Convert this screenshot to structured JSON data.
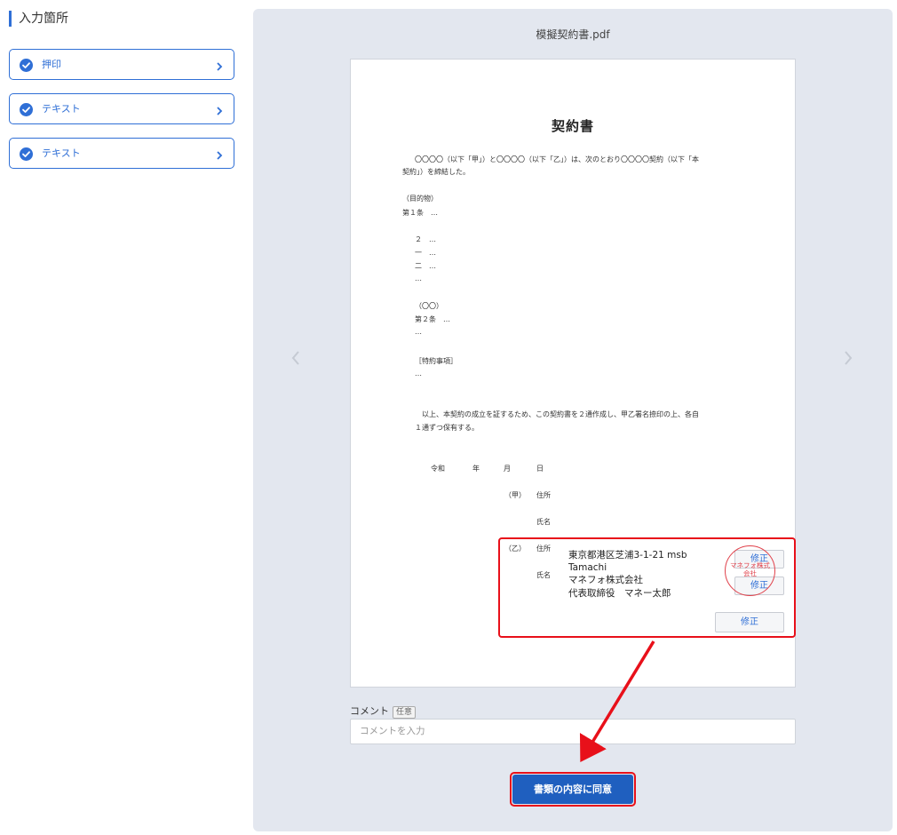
{
  "sidebar": {
    "title": "入力箇所",
    "items": [
      {
        "label": "押印"
      },
      {
        "label": "テキスト"
      },
      {
        "label": "テキスト"
      }
    ]
  },
  "viewer": {
    "filename": "模擬契約書.pdf",
    "doc_title": "契約書",
    "lines": [
      "〇〇〇〇（以下「甲」）と〇〇〇〇（以下「乙」）は、次のとおり〇〇〇〇契約（以下「本",
      "契約」）を締結した。",
      "（目的物）",
      "第１条　…",
      "２　…",
      "一　…",
      "二　…",
      "…",
      "（〇〇）",
      "第２条　…",
      "…",
      "［特約事項］",
      "…",
      "以上、本契約の成立を証するため、この契約書を２通作成し、甲乙署名捺印の上、各自",
      "１通ずつ保有する。"
    ],
    "date_row": {
      "era": "令和",
      "year": "年",
      "month": "月",
      "day": "日"
    },
    "party_a": {
      "tag": "（甲）",
      "address_label": "住所",
      "name_label": "氏名"
    },
    "party_b": {
      "tag": "（乙）",
      "address_label": "住所",
      "name_label": "氏名"
    },
    "signature": {
      "address_line1": "東京都港区芝浦3-1-21 msb",
      "address_line2": "Tamachi",
      "company": "マネフォ株式会社",
      "representative": "代表取締役　マネー太郎"
    },
    "stamp_text_1": "マネフォ株式",
    "stamp_text_2": "会社",
    "fix_button_label": "修正"
  },
  "comment": {
    "label": "コメント",
    "optional_badge": "任意",
    "placeholder": "コメントを入力"
  },
  "agree_button_label": "書類の内容に同意",
  "colors": {
    "accent": "#2f6fd6",
    "highlight": "#e8101a",
    "stamp": "#e0404a",
    "panel": "#e3e7ef"
  }
}
